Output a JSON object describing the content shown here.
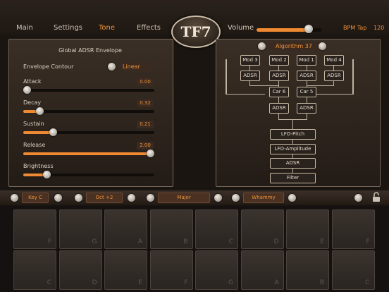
{
  "nav": {
    "tabs": [
      {
        "label": "Main",
        "active": false
      },
      {
        "label": "Settings",
        "active": false
      },
      {
        "label": "Tone",
        "active": true
      },
      {
        "label": "Effects",
        "active": false
      }
    ],
    "logo": "TF7",
    "volume_label": "Volume",
    "volume_level": 0.85,
    "bpm_label": "BPM Tap",
    "bpm_value": "120"
  },
  "envelope": {
    "title": "Global ADSR Envelope",
    "contour_label": "Envelope Contour",
    "contour_value": "Linear",
    "sliders": [
      {
        "label": "Attack",
        "value": "0.00",
        "level": 0.0
      },
      {
        "label": "Decay",
        "value": "0.32",
        "level": 0.1
      },
      {
        "label": "Sustain",
        "value": "0.21",
        "level": 0.21
      },
      {
        "label": "Release",
        "value": "2.00",
        "level": 1.0
      },
      {
        "label": "Brightness",
        "value": "",
        "level": 0.16
      }
    ]
  },
  "algorithm": {
    "label": "Algorithm 37",
    "mods": [
      "Mod 3",
      "Mod 2",
      "Mod 1",
      "Mod 4"
    ],
    "adsr": "ADSR",
    "carriers": [
      "Car 6",
      "Car 5"
    ],
    "chain": [
      "LFO-Pitch",
      "LFO-Amplitude",
      "ADSR",
      "Filter"
    ]
  },
  "selectors": {
    "key": "Key C",
    "octave": "Oct +2",
    "scale": "Major",
    "effect": "Whammy"
  },
  "pads": {
    "top_row": [
      "F",
      "G",
      "A",
      "B",
      "C",
      "D",
      "E",
      "F"
    ],
    "bottom_row": [
      "C",
      "D",
      "E",
      "F",
      "G",
      "A",
      "B",
      "C"
    ]
  },
  "colors": {
    "accent": "#f08a32",
    "background": "#1a1510"
  }
}
